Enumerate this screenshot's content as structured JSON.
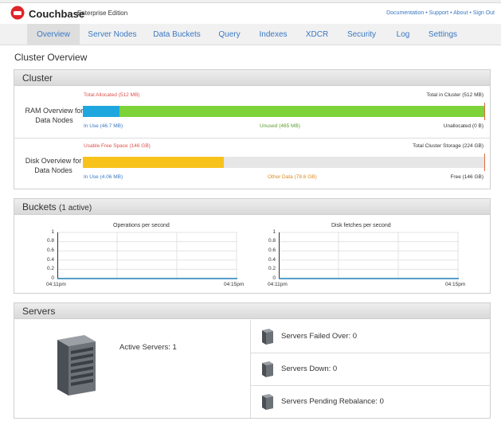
{
  "app": {
    "brand": "Couchbase",
    "edition": "Enterprise Edition"
  },
  "top_links": [
    "Documentation",
    "Support",
    "About",
    "Sign Out"
  ],
  "nav": {
    "tabs": [
      "Overview",
      "Server Nodes",
      "Data Buckets",
      "Query",
      "Indexes",
      "XDCR",
      "Security",
      "Log",
      "Settings"
    ],
    "active": "Overview"
  },
  "page_title": "Cluster Overview",
  "cluster": {
    "title": "Cluster",
    "ram": {
      "label": "RAM Overview for Data Nodes",
      "total_allocated": "Total Allocated (512 MB)",
      "total_in_cluster": "Total in Cluster (512 MB)",
      "in_use": "In Use (46.7 MB)",
      "unused": "Unused (465 MB)",
      "unallocated": "Unallocated (0 B)",
      "in_use_fraction": 0.091,
      "unused_fraction": 0.909
    },
    "disk": {
      "label": "Disk Overview for Data Nodes",
      "usable_free": "Usable Free Space (146 GB)",
      "total_storage": "Total Cluster Storage (224 GB)",
      "in_use": "In Use (4.06 MB)",
      "other_data": "Other Data (78.6 GB)",
      "free": "Free (146 GB)",
      "in_use_fraction": 0.0,
      "other_data_fraction": 0.351,
      "free_fraction": 0.649
    },
    "colors": {
      "ram_in_use": "#1ea7de",
      "ram_unused": "#7ed23a",
      "disk_other": "#f7c31b",
      "disk_free": "#e6e6e6",
      "marker": "#e36a3a"
    }
  },
  "buckets": {
    "title": "Buckets",
    "active_count": "(1 active)",
    "charts": [
      {
        "title": "Operations per second",
        "y_ticks": [
          "1",
          "0.8",
          "0.6",
          "0.4",
          "0.2",
          "0"
        ],
        "x_ticks": [
          "04:11pm",
          "04:15pm"
        ]
      },
      {
        "title": "Disk fetches per second",
        "y_ticks": [
          "1",
          "0.8",
          "0.6",
          "0.4",
          "0.2",
          "0"
        ],
        "x_ticks": [
          "04:11pm",
          "04:15pm"
        ]
      }
    ]
  },
  "servers": {
    "title": "Servers",
    "active": "Active Servers: 1",
    "failed_over": "Servers Failed Over: 0",
    "down": "Servers Down: 0",
    "pending_rebalance": "Servers Pending Rebalance: 0",
    "icon": "server-tower-icon"
  }
}
